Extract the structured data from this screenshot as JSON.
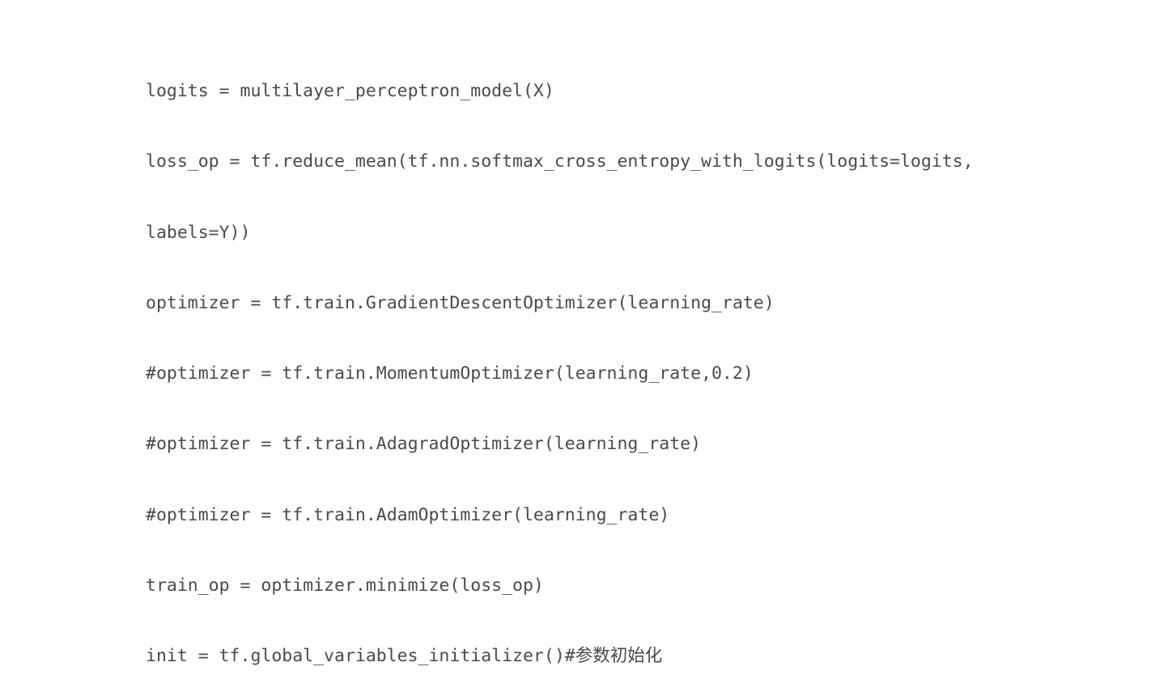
{
  "code": {
    "lines": [
      "logits = multilayer_perceptron_model(X)",
      "loss_op = tf.reduce_mean(tf.nn.softmax_cross_entropy_with_logits(logits=logits,",
      "labels=Y))",
      "optimizer = tf.train.GradientDescentOptimizer(learning_rate)",
      "#optimizer = tf.train.MomentumOptimizer(learning_rate,0.2)",
      "#optimizer = tf.train.AdagradOptimizer(learning_rate)",
      "#optimizer = tf.train.AdamOptimizer(learning_rate)",
      "train_op = optimizer.minimize(loss_op)",
      "init = tf.global_variables_initializer()#参数初始化"
    ]
  }
}
